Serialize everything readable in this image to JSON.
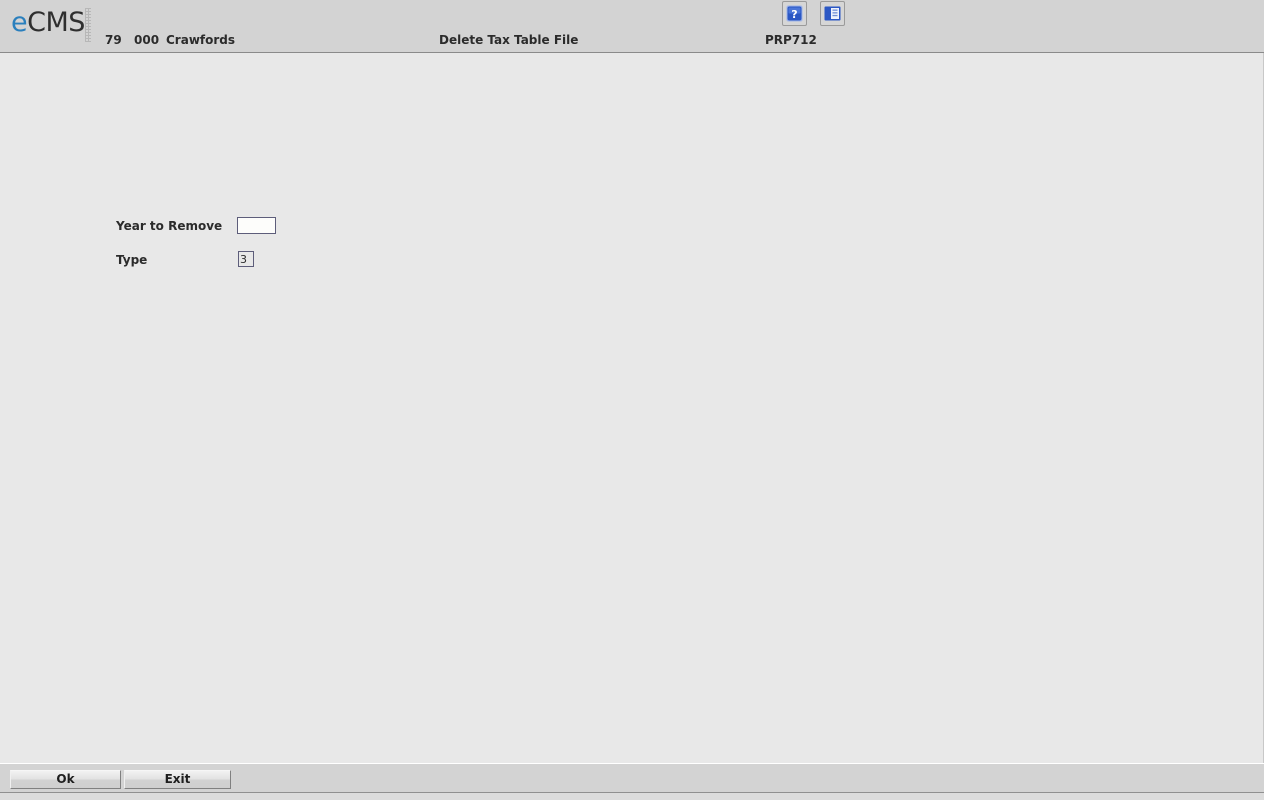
{
  "header": {
    "logo": {
      "prefix": "e",
      "suffix": "CMS"
    },
    "company_code": "79",
    "division_code": "000",
    "company_name": "Crawfords",
    "screen_title": "Delete Tax Table File",
    "program_id": "PRP712",
    "toolbar": [
      {
        "name": "help-icon",
        "label": "?"
      },
      {
        "name": "window-list-icon",
        "label": ""
      }
    ]
  },
  "form": {
    "year_to_remove": {
      "label": "Year to Remove",
      "value": "",
      "placeholder": ""
    },
    "type": {
      "label": "Type",
      "value": "3"
    }
  },
  "footer": {
    "ok_label": "Ok",
    "exit_label": "Exit"
  },
  "colors": {
    "header_bg": "#d3d3d3",
    "body_bg": "#e8e8e8",
    "footer_bg": "#d3d3d3",
    "logo_accent": "#2a7fbd",
    "logo_text": "#2f2f2f",
    "field_border": "#5d5d7a",
    "icon_blue": "#2b57c4"
  }
}
